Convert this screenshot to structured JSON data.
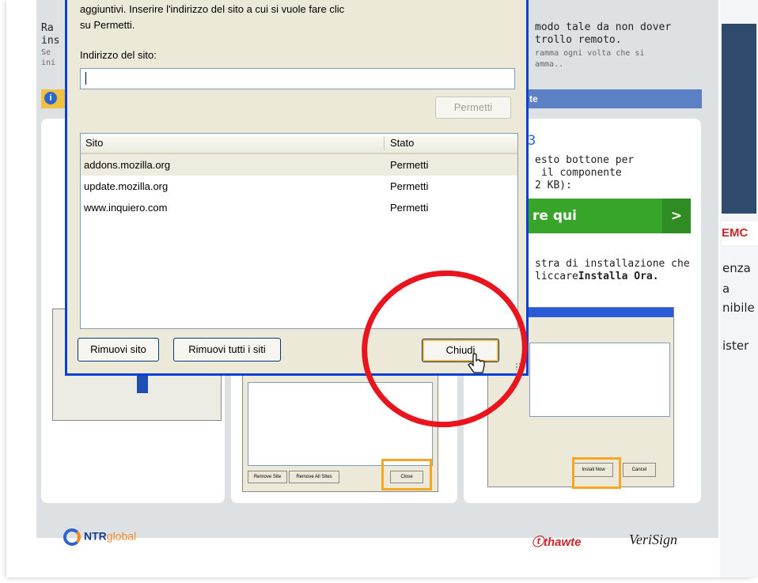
{
  "dialog": {
    "intro_line1": "aggiuntivi. Inserire l'indirizzo del sito a cui si vuole fare clic",
    "intro_line2": "su Permetti.",
    "address_label": "Indirizzo del sito:",
    "address_value": "",
    "allow_button": "Permetti",
    "columns": {
      "site": "Sito",
      "status": "Stato"
    },
    "rows": [
      {
        "site": "addons.mozilla.org",
        "status": "Permetti"
      },
      {
        "site": "update.mozilla.org",
        "status": "Permetti"
      },
      {
        "site": "www.inquiero.com",
        "status": "Permetti"
      }
    ],
    "remove_site_button": "Rimuovi sito",
    "remove_all_button": "Rimuovi tutti i siti",
    "close_button": "Chiudi"
  },
  "background": {
    "right_text_1": "modo tale da non dover",
    "right_text_2": "trollo remoto.",
    "right_small_1": "ramma ogni volta che si",
    "right_small_2": "amma..",
    "blue_bar": "te",
    "step_number": "3",
    "step_text_1": "esto bottone per",
    "step_text_2": "il componente",
    "step_text_3": "2 KB):",
    "green_button": "re qui",
    "green_arrow": ">",
    "install_text_1": "stra di installazione che",
    "install_text_2": "liccare",
    "install_text_bold": "Installa Ora.",
    "left_frag_1": "Ra",
    "left_frag_2": "ins",
    "left_frag_3": "Se",
    "left_frag_4": "ini",
    "right_emc": "EMC",
    "right_enza": "enza",
    "right_a": "a",
    "right_nibile": "nibile",
    "right_ister": "ister",
    "thumb_install_now": "Install Now",
    "thumb_cancel": "Cancel",
    "thumb_close": "Close",
    "thumb_remove_site": "Remove Site",
    "thumb_remove_all": "Remove All Sites"
  },
  "footer": {
    "ntr_logo_main": "NTR",
    "ntr_logo_sub": "global",
    "thawte_logo": "thawte",
    "verisign_logo": "VeriSign"
  },
  "colors": {
    "dialog_border": "#0a3fd8",
    "highlight_circle": "#e8141e",
    "highlight_box": "#f5a623",
    "green_button": "#36a52a"
  }
}
